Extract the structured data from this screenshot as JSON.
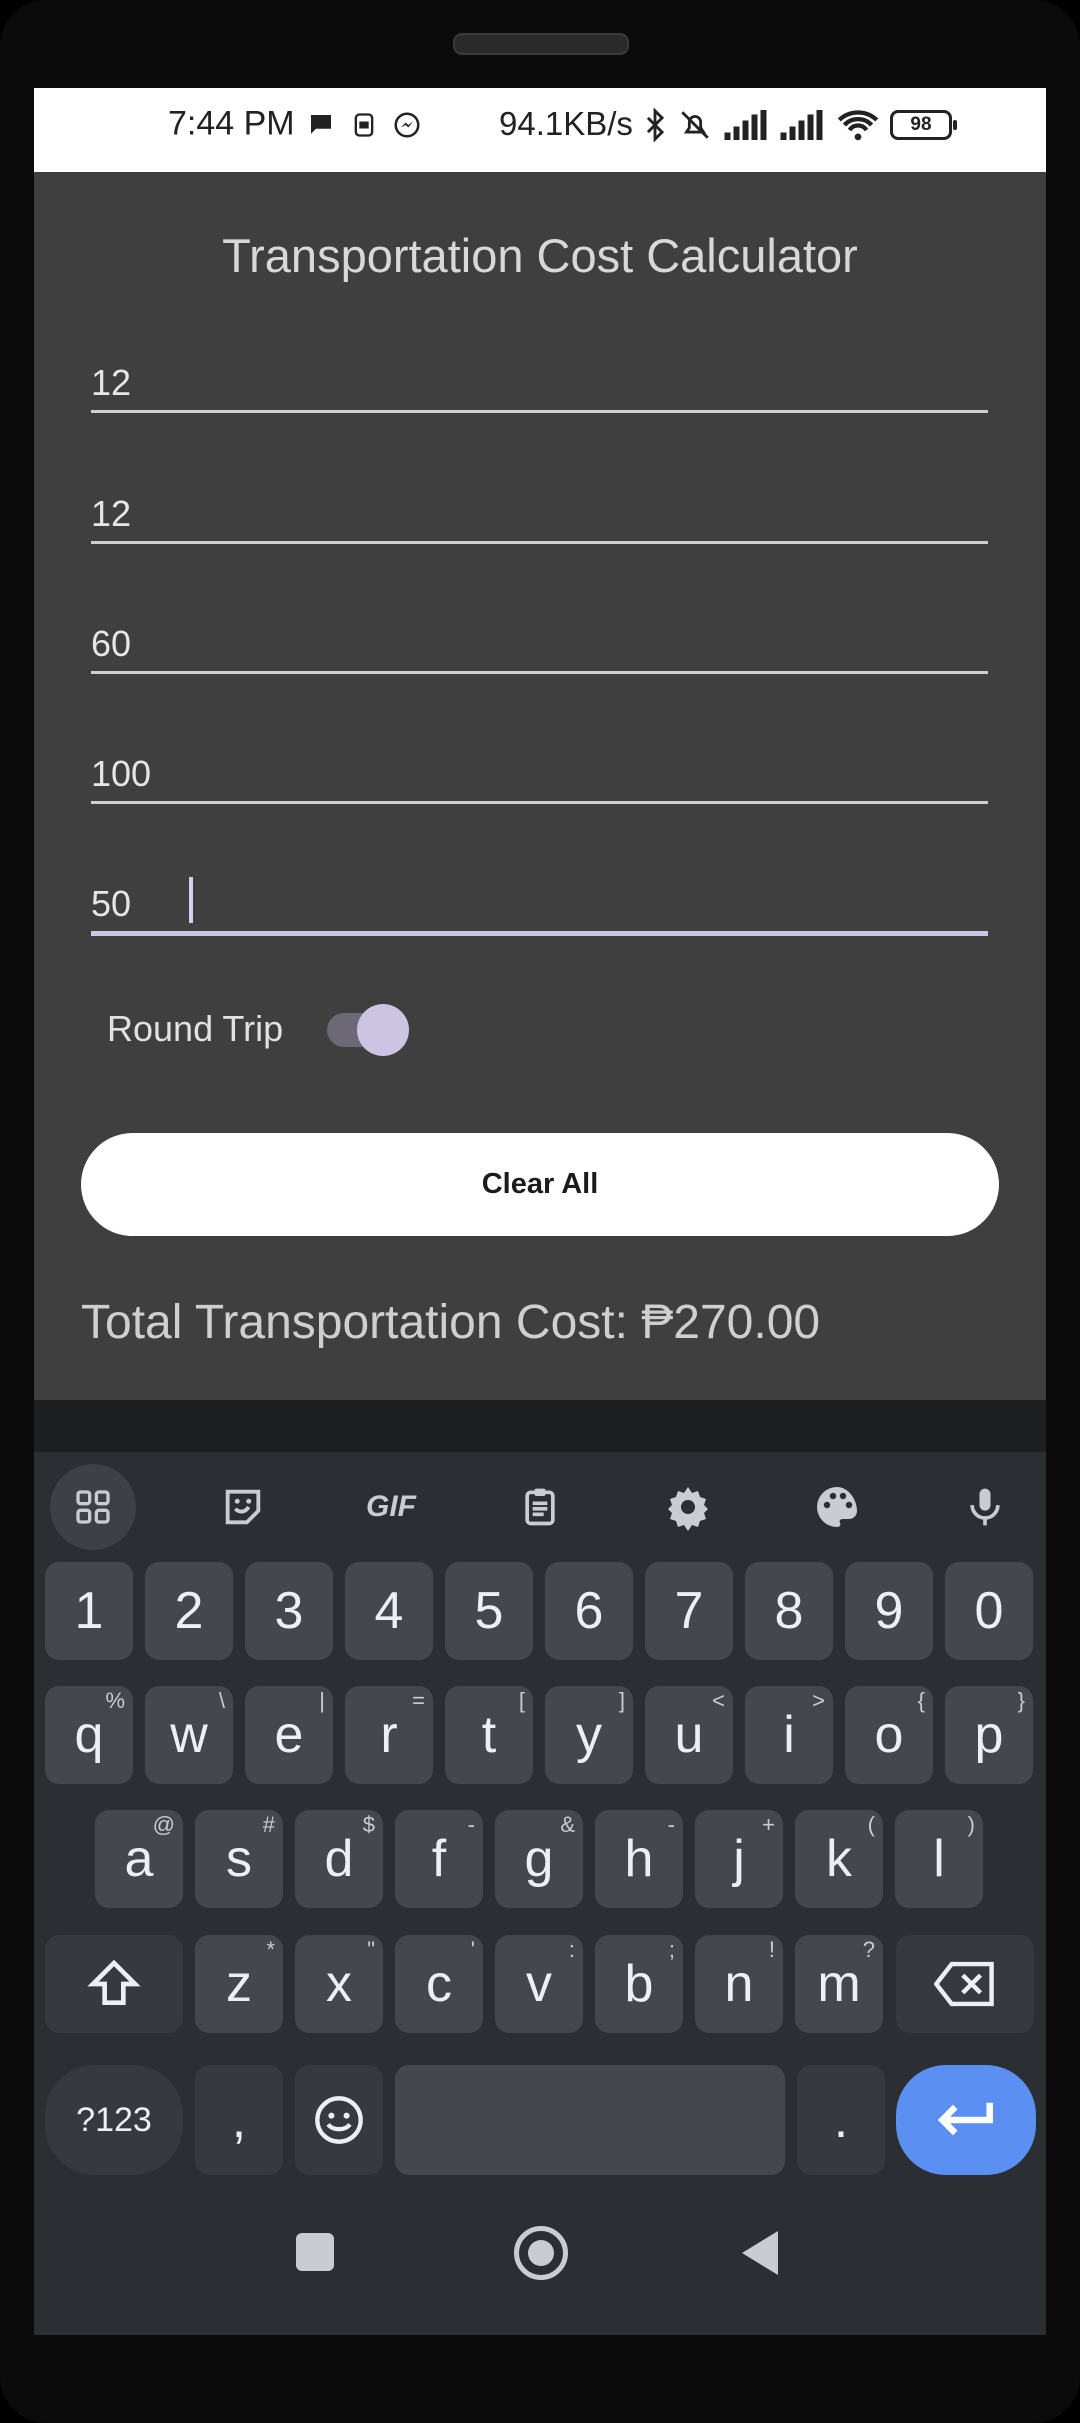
{
  "status_bar": {
    "time": "7:44 PM",
    "speed": "94.1KB/s",
    "battery": "98",
    "icons_left": [
      "chat-bubble-icon",
      "sim-icon",
      "messenger-icon"
    ],
    "icons_right": [
      "bluetooth-icon",
      "mute-icon",
      "signal-icon",
      "signal-icon",
      "wifi-icon"
    ]
  },
  "app": {
    "title": "Transportation Cost Calculator",
    "fields": [
      {
        "value": "12"
      },
      {
        "value": "12"
      },
      {
        "value": "60"
      },
      {
        "value": "100"
      },
      {
        "value": "50"
      }
    ],
    "round_trip_label": "Round Trip",
    "round_trip_on": true,
    "clear_button": "Clear All",
    "total_text": "Total Transportation Cost: ₱270.00"
  },
  "keyboard": {
    "toolbar": [
      "apps-icon",
      "sticker-icon",
      "gif-icon",
      "clipboard-icon",
      "settings-icon",
      "palette-icon",
      "mic-icon"
    ],
    "gif_label": "GIF",
    "row_numbers": [
      "1",
      "2",
      "3",
      "4",
      "5",
      "6",
      "7",
      "8",
      "9",
      "0"
    ],
    "row_q": [
      [
        "q",
        "%"
      ],
      [
        "w",
        "\\"
      ],
      [
        "e",
        "|"
      ],
      [
        "r",
        "="
      ],
      [
        "t",
        "["
      ],
      [
        "y",
        "]"
      ],
      [
        "u",
        "<"
      ],
      [
        "i",
        ">"
      ],
      [
        "o",
        "{"
      ],
      [
        "p",
        "}"
      ]
    ],
    "row_a": [
      [
        "a",
        "@"
      ],
      [
        "s",
        "#"
      ],
      [
        "d",
        "$"
      ],
      [
        "f",
        "-"
      ],
      [
        "g",
        "&"
      ],
      [
        "h",
        "-"
      ],
      [
        "j",
        "+"
      ],
      [
        "k",
        "("
      ],
      [
        "l",
        ")"
      ]
    ],
    "row_z": [
      [
        "z",
        "*"
      ],
      [
        "x",
        "\""
      ],
      [
        "c",
        "'"
      ],
      [
        "v",
        ":"
      ],
      [
        "b",
        ";"
      ],
      [
        "n",
        "!"
      ],
      [
        "m",
        "?"
      ]
    ],
    "sym_label": "?123",
    "comma": ",",
    "period": "."
  },
  "colors": {
    "app_bg": "#3f3f3f",
    "accent": "#cfc4e4",
    "enter_key": "#5b8ff2"
  }
}
